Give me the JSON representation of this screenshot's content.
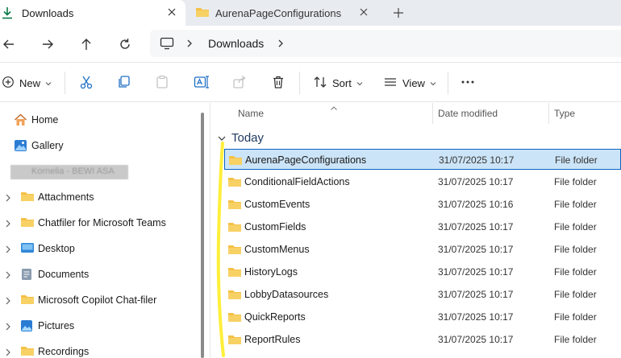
{
  "tabs": [
    {
      "label": "Downloads",
      "active": true,
      "icon": "download-icon"
    },
    {
      "label": "AurenaPageConfigurations",
      "active": false,
      "icon": "folder-icon"
    }
  ],
  "address": {
    "location": "This PC",
    "crumb": "Downloads"
  },
  "commands": {
    "new_label": "New",
    "sort_label": "Sort",
    "view_label": "View"
  },
  "sidebar": {
    "pinned": [
      {
        "label": "Home",
        "icon": "home-icon"
      },
      {
        "label": "Gallery",
        "icon": "gallery-icon"
      }
    ],
    "account_redacted": "Kornelia - BEWI ASA",
    "items": [
      {
        "label": "Attachments",
        "icon": "folder-icon"
      },
      {
        "label": "Chatfiler for Microsoft Teams",
        "icon": "folder-icon"
      },
      {
        "label": "Desktop",
        "icon": "desktop-icon"
      },
      {
        "label": "Documents",
        "icon": "documents-icon"
      },
      {
        "label": "Microsoft Copilot Chat-filer",
        "icon": "folder-icon"
      },
      {
        "label": "Pictures",
        "icon": "pictures-icon"
      },
      {
        "label": "Recordings",
        "icon": "folder-icon"
      }
    ]
  },
  "columns": {
    "name": "Name",
    "date": "Date modified",
    "type": "Type"
  },
  "group": {
    "label": "Today"
  },
  "files": [
    {
      "name": "AurenaPageConfigurations",
      "date": "31/07/2025 10:17",
      "type": "File folder",
      "selected": true
    },
    {
      "name": "ConditionalFieldActions",
      "date": "31/07/2025 10:17",
      "type": "File folder"
    },
    {
      "name": "CustomEvents",
      "date": "31/07/2025 10:16",
      "type": "File folder"
    },
    {
      "name": "CustomFields",
      "date": "31/07/2025 10:17",
      "type": "File folder"
    },
    {
      "name": "CustomMenus",
      "date": "31/07/2025 10:17",
      "type": "File folder"
    },
    {
      "name": "HistoryLogs",
      "date": "31/07/2025 10:17",
      "type": "File folder"
    },
    {
      "name": "LobbyDatasources",
      "date": "31/07/2025 10:17",
      "type": "File folder"
    },
    {
      "name": "QuickReports",
      "date": "31/07/2025 10:17",
      "type": "File folder"
    },
    {
      "name": "ReportRules",
      "date": "31/07/2025 10:17",
      "type": "File folder"
    }
  ],
  "colors": {
    "folder": "#f4c146",
    "selection": "#cce4f7",
    "selection_border": "#0a64c2",
    "highlight": "#ffef3a",
    "accent": "#0a7a4a"
  }
}
